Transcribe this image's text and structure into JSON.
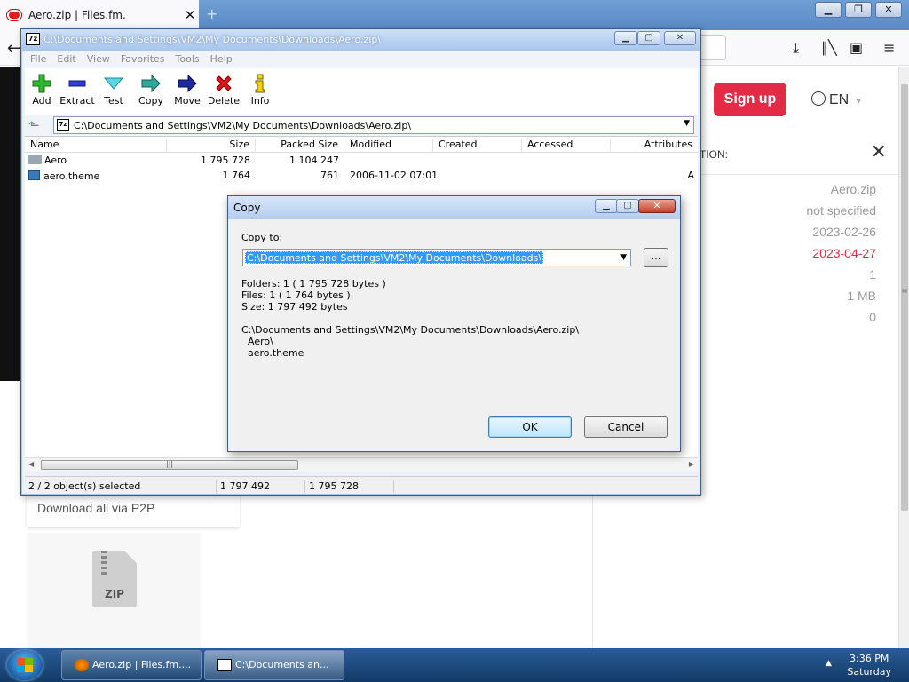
{
  "browser": {
    "tab_title": "Aero.zip | Files.fm.",
    "tab_close": "✕",
    "newtab": "+",
    "win_minimize": "▁",
    "win_restore": "❐",
    "win_close": "✕"
  },
  "site": {
    "signup_label": "Sign up",
    "lang_label": "EN",
    "info_header": "TION:",
    "info_values": [
      "Aero.zip",
      "not specified",
      "2023-02-26",
      "2023-04-27",
      "1",
      "1 MB",
      "0"
    ],
    "p2p_label": "Download all via P2P",
    "zip_label": "ZIP"
  },
  "sevenzip": {
    "icon_text": "7z",
    "title": "C:\\Documents and Settings\\VM2\\My Documents\\Downloads\\Aero.zip\\",
    "menu": [
      "File",
      "Edit",
      "View",
      "Favorites",
      "Tools",
      "Help"
    ],
    "tools": [
      "Add",
      "Extract",
      "Test",
      "Copy",
      "Move",
      "Delete",
      "Info"
    ],
    "address": "C:\\Documents and Settings\\VM2\\My Documents\\Downloads\\Aero.zip\\",
    "columns": [
      "Name",
      "Size",
      "Packed Size",
      "Modified",
      "Created",
      "Accessed",
      "Attributes"
    ],
    "rows": [
      {
        "name": "Aero",
        "size": "1 795 728",
        "packed": "1 104 247",
        "modified": "",
        "attr": ""
      },
      {
        "name": "aero.theme",
        "size": "1 764",
        "packed": "761",
        "modified": "2006-11-02 07:01",
        "attr": "A"
      }
    ],
    "status": {
      "selected": "2 / 2 object(s) selected",
      "size": "1 797 492",
      "packed": "1 795 728"
    }
  },
  "copy_dialog": {
    "title": "Copy",
    "copy_to_label": "Copy to:",
    "destination": "C:\\Documents and Settings\\VM2\\My Documents\\Downloads\\",
    "browse_label": "...",
    "stats": {
      "folders": "Folders: 1    ( 1 795 728 bytes )",
      "files": "Files: 1    ( 1 764 bytes )",
      "size": "Size: 1 797 492 bytes"
    },
    "paths": "C:\\Documents and Settings\\VM2\\My Documents\\Downloads\\Aero.zip\\\n  Aero\\\n  aero.theme",
    "ok_label": "OK",
    "cancel_label": "Cancel"
  },
  "taskbar": {
    "tasks": [
      "Aero.zip | Files.fm....",
      "C:\\Documents an..."
    ],
    "time": "3:36 PM",
    "day": "Saturday"
  }
}
